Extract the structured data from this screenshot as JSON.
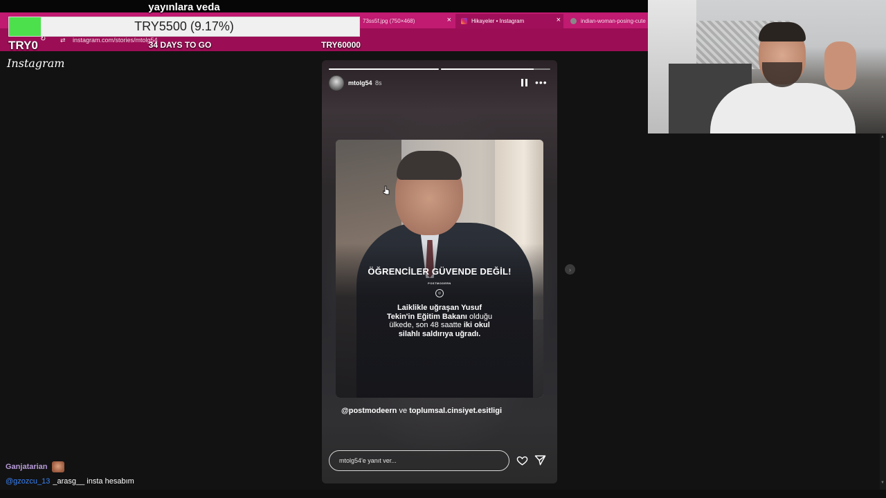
{
  "browser": {
    "tabs": [
      {
        "label": "73ss5f.jpg (750×468)",
        "active": false
      },
      {
        "label": "Hikayeler • Instagram",
        "active": true
      },
      {
        "label": "indian-woman-posing-cute",
        "active": false
      }
    ],
    "url": "instagram.com/stories/mtolg54"
  },
  "overlay": {
    "title": "yayınlara veda",
    "progress_text": "TRY5500 (9.17%)",
    "progress_fraction": 0.0917,
    "start_label": "TRY0",
    "days_label": "34 DAYS TO GO",
    "goal_label": "TRY60000"
  },
  "instagram": {
    "logo": "Instagram",
    "story": {
      "username": "mtolg54",
      "time": "8s",
      "progress_segments": [
        1,
        0.85
      ],
      "headline": "ÖĞRENCİLER GÜVENDE DEĞİL!",
      "brand": "POSTMODERN",
      "body_line1": "Laiklikle uğraşan Yusuf",
      "body_line2_bold": "Tekin'in Eğitim Bakanı",
      "body_line2_rest": " olduğu",
      "body_line3_rest": "ülkede, son 48 saatte ",
      "body_line3_bold": "iki okul",
      "body_line4": "silahlı saldırıya uğradı.",
      "mention1": "@postmodeern",
      "mention_joiner": " ve ",
      "mention2": "toplumsal.cinsiyet.esitligi",
      "reply_placeholder": "mtolg54'e yanıt ver..."
    }
  },
  "chat": [
    {
      "user": "Ganjatarian",
      "text": ""
    },
    {
      "user": "@gzozcu_13",
      "text": "_arasg__ insta hesabım"
    }
  ],
  "colors": {
    "tabstrip": "#c01a71",
    "addressbar": "#9b0e55",
    "progress_fill": "#4ce04c",
    "chat_user1": "#b79bd8",
    "chat_user2": "#3b82f6"
  }
}
